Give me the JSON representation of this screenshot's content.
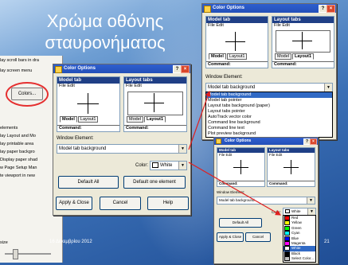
{
  "slide": {
    "title_line1": "Χρώμα οθόνης",
    "title_line2": "σταυρονήματος",
    "footer_date": "16 Δεκεμβρίου 2012",
    "page_number": "21"
  },
  "options_panel": {
    "lines": [
      "lay scroll bars in dra",
      "lay screen menu",
      "elements",
      "lay Layout and Mo",
      "lay printable area",
      "lay paper backgro",
      "Display paper shad",
      "w Page Setup Man",
      "te viewport in new",
      "size"
    ],
    "colors_button": "Colors..."
  },
  "dialog": {
    "title": "Color Options",
    "help_btn": "?",
    "close_btn": "×",
    "model_tab_header": "Model tab",
    "layout_tabs_header": "Layout tabs",
    "menu_file_edit": "File  Edit",
    "tab_model": "Model",
    "tab_layout1": "Layout1",
    "command_label": "Command:",
    "window_element_label": "Window Element:",
    "window_element_value": "Model tab background",
    "color_label": "Color:",
    "color_value": "White",
    "default_all": "Default All",
    "default_one": "Default one element",
    "apply_close": "Apply & Close",
    "cancel": "Cancel",
    "help": "Help"
  },
  "element_list": [
    "Model tab background",
    "Model tab pointer",
    "Layout tabs background (paper)",
    "Layout tabs pointer",
    "AutoTrack vector color",
    "Command line background",
    "Command line text",
    "Plot preview background"
  ],
  "color_list": [
    {
      "name": "Red",
      "hex": "#ff0000"
    },
    {
      "name": "Yellow",
      "hex": "#ffff00"
    },
    {
      "name": "Green",
      "hex": "#00ff00"
    },
    {
      "name": "Cyan",
      "hex": "#00ffff"
    },
    {
      "name": "Blue",
      "hex": "#0000ff"
    },
    {
      "name": "Magenta",
      "hex": "#ff00ff"
    },
    {
      "name": "White",
      "hex": "#ffffff"
    },
    {
      "name": "Black",
      "hex": "#000000"
    },
    {
      "name": "Select Color...",
      "hex": "#c0c0c0"
    }
  ],
  "colors": {
    "accent_arrow": "#e02020",
    "title_bar": "#2350b8",
    "swatch_white": "#ffffff"
  }
}
